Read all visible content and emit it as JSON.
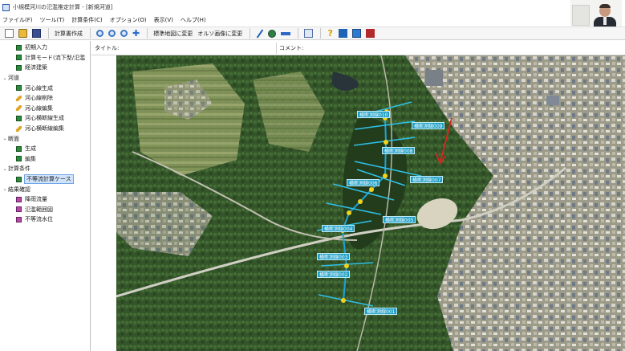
{
  "window": {
    "title": "小規模河川の氾濫推定計算 - [新規河道]"
  },
  "menu": [
    "ファイル(F)",
    "ツール(T)",
    "計算条件(C)",
    "オプション(O)",
    "表示(V)",
    "ヘルプ(H)"
  ],
  "toolbar": {
    "calc_button": "計算書作成",
    "std_map_button": "標準地図に変更",
    "ortho_button": "オルソ画像に変更"
  },
  "tree": [
    {
      "label": "初期入力",
      "icon": "green",
      "expand": ""
    },
    {
      "label": "計算モード(流下型/氾濫",
      "icon": "green",
      "expand": ""
    },
    {
      "label": "経済建築",
      "icon": "green",
      "expand": ""
    },
    {
      "label": "河道",
      "icon": "none",
      "expand": "v"
    },
    {
      "label": "河心線生成",
      "icon": "green",
      "expand": ""
    },
    {
      "label": "河心線削除",
      "icon": "pencil",
      "expand": ""
    },
    {
      "label": "河心線編集",
      "icon": "pencil",
      "expand": ""
    },
    {
      "label": "河心横断線生成",
      "icon": "green",
      "expand": ""
    },
    {
      "label": "河心横断線編集",
      "icon": "pencil",
      "expand": ""
    },
    {
      "label": "断面",
      "icon": "none",
      "expand": "v"
    },
    {
      "label": "生成",
      "icon": "green",
      "expand": ""
    },
    {
      "label": "編集",
      "icon": "green",
      "expand": ""
    },
    {
      "label": "計算条件",
      "icon": "none",
      "expand": "v"
    },
    {
      "label": "不等流計算ケース",
      "icon": "green",
      "expand": "",
      "selected": true
    },
    {
      "label": "結果確認",
      "icon": "none",
      "expand": "v"
    },
    {
      "label": "降雨流量",
      "icon": "purple",
      "expand": ""
    },
    {
      "label": "氾濫範囲図",
      "icon": "purple",
      "expand": ""
    },
    {
      "label": "不等流水位",
      "icon": "purple",
      "expand": ""
    }
  ],
  "info": {
    "title_label": "タイトル:",
    "comment_label": "コメント:"
  },
  "map": {
    "section_labels": [
      "横断測線010",
      "横断測線009",
      "横断測線008",
      "横断測線007",
      "横断測線006",
      "横断測線005",
      "横断測線004",
      "横断測線003",
      "横断測線002",
      "横断測線001"
    ]
  },
  "colors": {
    "section_line": "#2ec0e6",
    "centerline": "#1fa2d6",
    "node": "#f3d21b",
    "flow_arrow": "#d5291f"
  }
}
